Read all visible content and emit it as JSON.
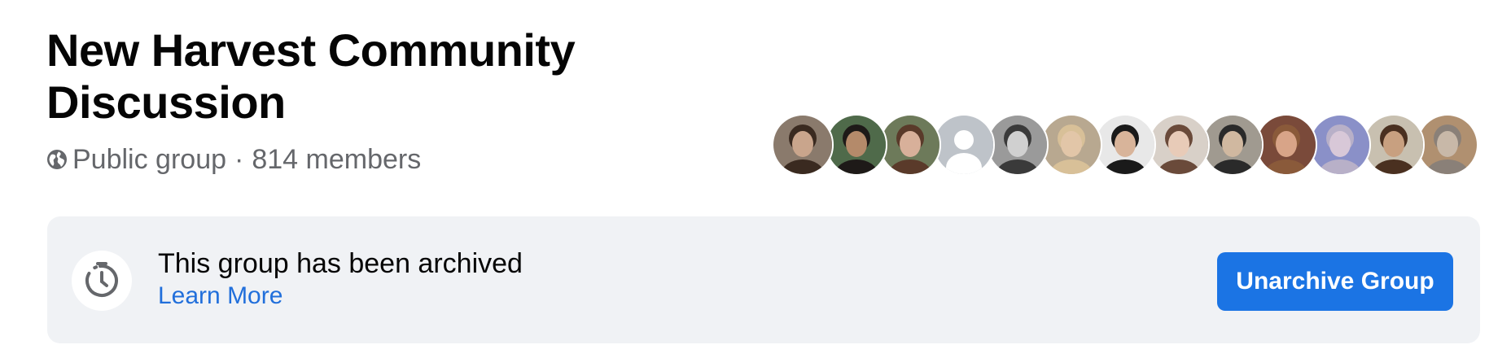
{
  "group": {
    "name": "New Harvest Community Discussion",
    "privacy": "Public group",
    "separator": "·",
    "member_count": "814 members"
  },
  "member_avatars": [
    {
      "name": "member-1",
      "bg": "#8a7a6c",
      "skin": "#c9a58c",
      "hair": "#3a2a20"
    },
    {
      "name": "member-2",
      "bg": "#4f6a4a",
      "skin": "#b48a6a",
      "hair": "#1e1a18"
    },
    {
      "name": "member-3",
      "bg": "#6d7a5a",
      "skin": "#d8b09a",
      "hair": "#5a3a2a"
    },
    {
      "name": "member-4-default",
      "bg": "#bec3c9",
      "skin": "#ffffff",
      "hair": "#bec3c9"
    },
    {
      "name": "member-5",
      "bg": "#9a9a9a",
      "skin": "#d0d0d0",
      "hair": "#3a3a3a"
    },
    {
      "name": "member-6",
      "bg": "#b8a890",
      "skin": "#e2c6a8",
      "hair": "#d8c098"
    },
    {
      "name": "member-7",
      "bg": "#e8e8e8",
      "skin": "#d8b49a",
      "hair": "#1a1a1a"
    },
    {
      "name": "member-8",
      "bg": "#d8d0c8",
      "skin": "#e8cbb8",
      "hair": "#6a4a3a"
    },
    {
      "name": "member-9",
      "bg": "#a09a90",
      "skin": "#d0b8a0",
      "hair": "#2a2a2a"
    },
    {
      "name": "member-10",
      "bg": "#7a4a3a",
      "skin": "#d8a488",
      "hair": "#8a5a3a"
    },
    {
      "name": "member-11",
      "bg": "#8a90c8",
      "skin": "#d8c8d8",
      "hair": "#b8b0c8"
    },
    {
      "name": "member-12",
      "bg": "#c8c0b0",
      "skin": "#c8a080",
      "hair": "#4a3020"
    },
    {
      "name": "member-13",
      "bg": "#b09070",
      "skin": "#c8b8a8",
      "hair": "#8a8078"
    }
  ],
  "archive_banner": {
    "title": "This group has been archived",
    "learn_more": "Learn More",
    "button_label": "Unarchive Group",
    "icon": "archive-clock-icon"
  },
  "colors": {
    "primary_blue": "#1b74e4",
    "link_blue": "#216fdb",
    "banner_bg": "#f0f2f5",
    "secondary_text": "#65676b"
  }
}
